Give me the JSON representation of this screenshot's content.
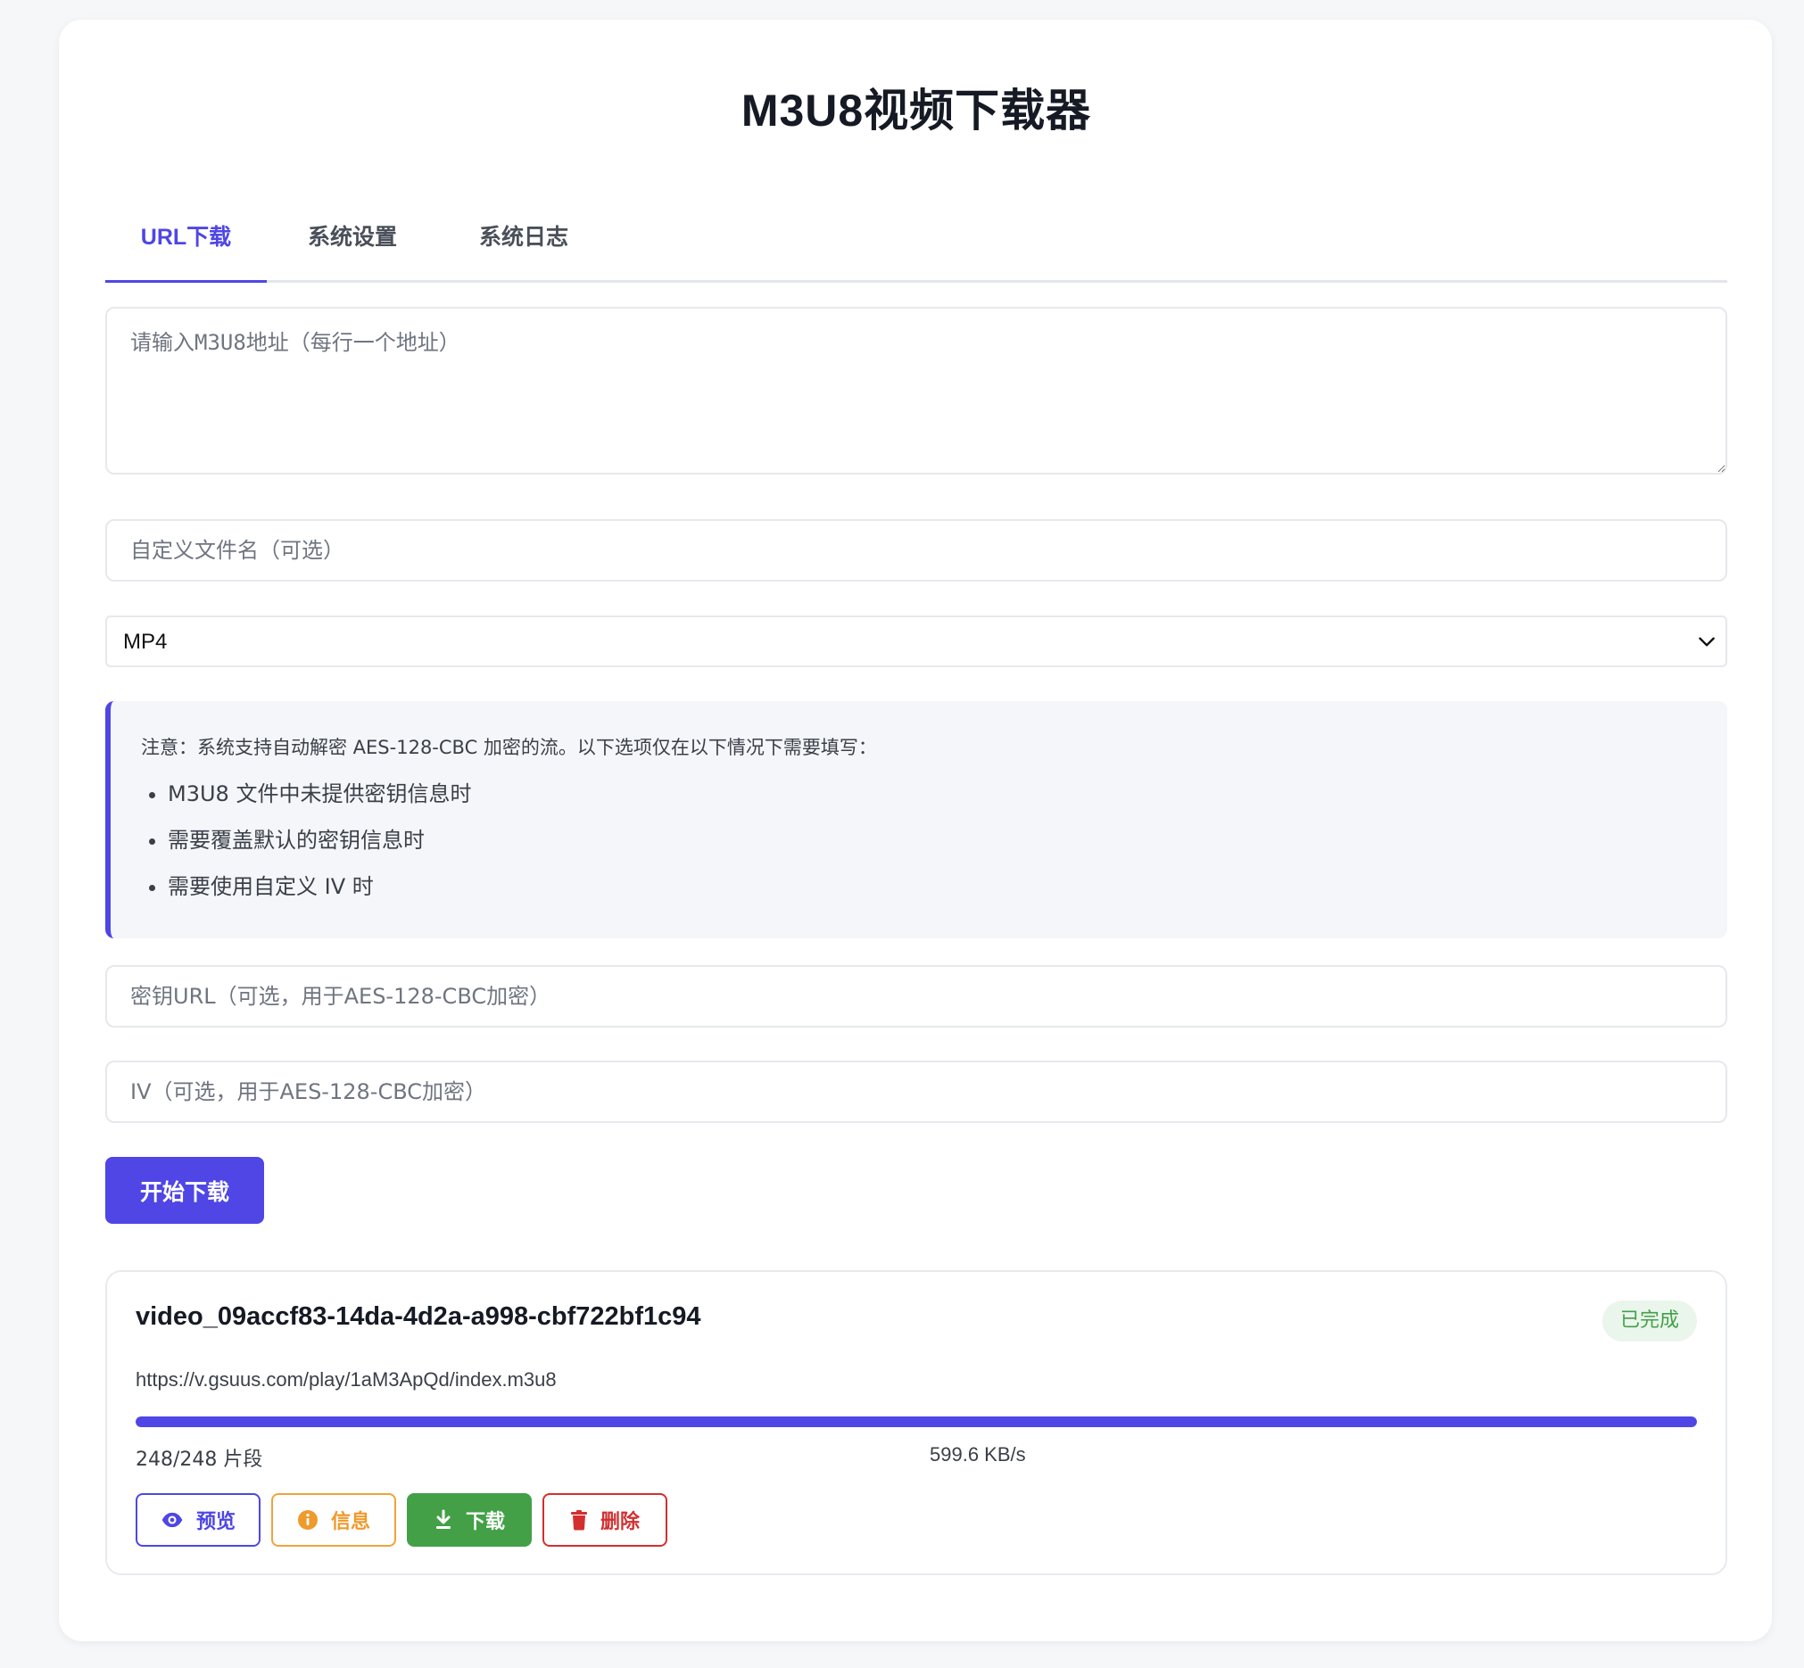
{
  "app": {
    "title": "M3U8视频下载器"
  },
  "tabs": [
    {
      "label": "URL下载",
      "active": true
    },
    {
      "label": "系统设置",
      "active": false
    },
    {
      "label": "系统日志",
      "active": false
    }
  ],
  "form": {
    "urls_placeholder": "请输入M3U8地址（每行一个地址）",
    "urls_value": "",
    "filename_placeholder": "自定义文件名（可选）",
    "filename_value": "",
    "format_selected": "MP4",
    "key_url_placeholder": "密钥URL（可选，用于AES-128-CBC加密）",
    "key_url_value": "",
    "iv_placeholder": "IV（可选，用于AES-128-CBC加密）",
    "iv_value": "",
    "start_button": "开始下载"
  },
  "notice": {
    "text": "注意：系统支持自动解密 AES-128-CBC 加密的流。以下选项仅在以下情况下需要填写：",
    "items": [
      "M3U8 文件中未提供密钥信息时",
      "需要覆盖默认的密钥信息时",
      "需要使用自定义 IV 时"
    ]
  },
  "task": {
    "name": "video_09accf83-14da-4d2a-a998-cbf722bf1c94",
    "status": "已完成",
    "url": "https://v.gsuus.com/play/1aM3ApQd/index.m3u8",
    "progress_fraction": 1.0,
    "segments": "248/248 片段",
    "speed": "599.6 KB/s",
    "actions": {
      "preview": "预览",
      "info": "信息",
      "download": "下载",
      "delete": "删除"
    }
  },
  "colors": {
    "accent": "#4f46e5",
    "success": "#43a047",
    "warning": "#ef9a2c",
    "danger": "#d32f2f"
  },
  "icons": {
    "preview": "eye-icon",
    "info": "info-circle-icon",
    "download": "download-icon",
    "delete": "trash-icon",
    "select": "chevron-down-icon"
  }
}
